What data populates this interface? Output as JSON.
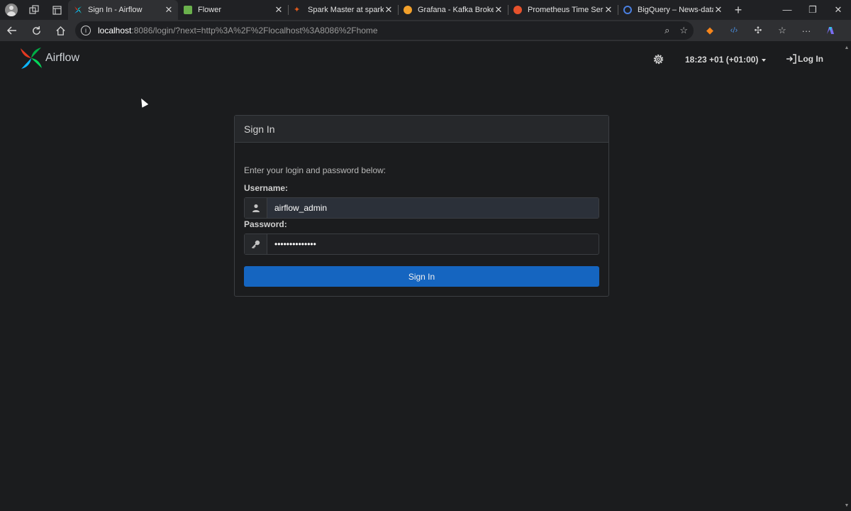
{
  "browser": {
    "tabs": [
      {
        "title": "Sign In - Airflow",
        "active": true,
        "favicon": "airflow-favicon",
        "color": "#2b8dd6"
      },
      {
        "title": "Flower",
        "active": false,
        "favicon": "flower-favicon",
        "color": "#6ab04c"
      },
      {
        "title": "Spark Master at spark://a",
        "active": false,
        "favicon": "spark-favicon",
        "color": "#e25a1c"
      },
      {
        "title": "Grafana - Kafka Brokers O",
        "active": false,
        "favicon": "grafana-favicon",
        "color": "#f2a02b"
      },
      {
        "title": "Prometheus Time Series C",
        "active": false,
        "favicon": "prometheus-favicon",
        "color": "#e6522c"
      },
      {
        "title": "BigQuery – News-data-en",
        "active": false,
        "favicon": "bigquery-favicon",
        "color": "#4a7fe0"
      }
    ],
    "address": {
      "host": "localhost",
      "path": ":8086/login/?next=http%3A%2F%2Flocalhost%3A8086%2Fhome"
    }
  },
  "navbar": {
    "brand": "Airflow",
    "time": "18:23 +01 (+01:00)",
    "login_label": "Log In"
  },
  "signin": {
    "title": "Sign In",
    "hint": "Enter your login and password below:",
    "username_label": "Username:",
    "username_value": "airflow_admin",
    "password_label": "Password:",
    "password_value": "••••••••••••••",
    "button_label": "Sign In"
  },
  "colors": {
    "page_bg": "#1b1c1e",
    "primary_button": "#1565c0"
  }
}
